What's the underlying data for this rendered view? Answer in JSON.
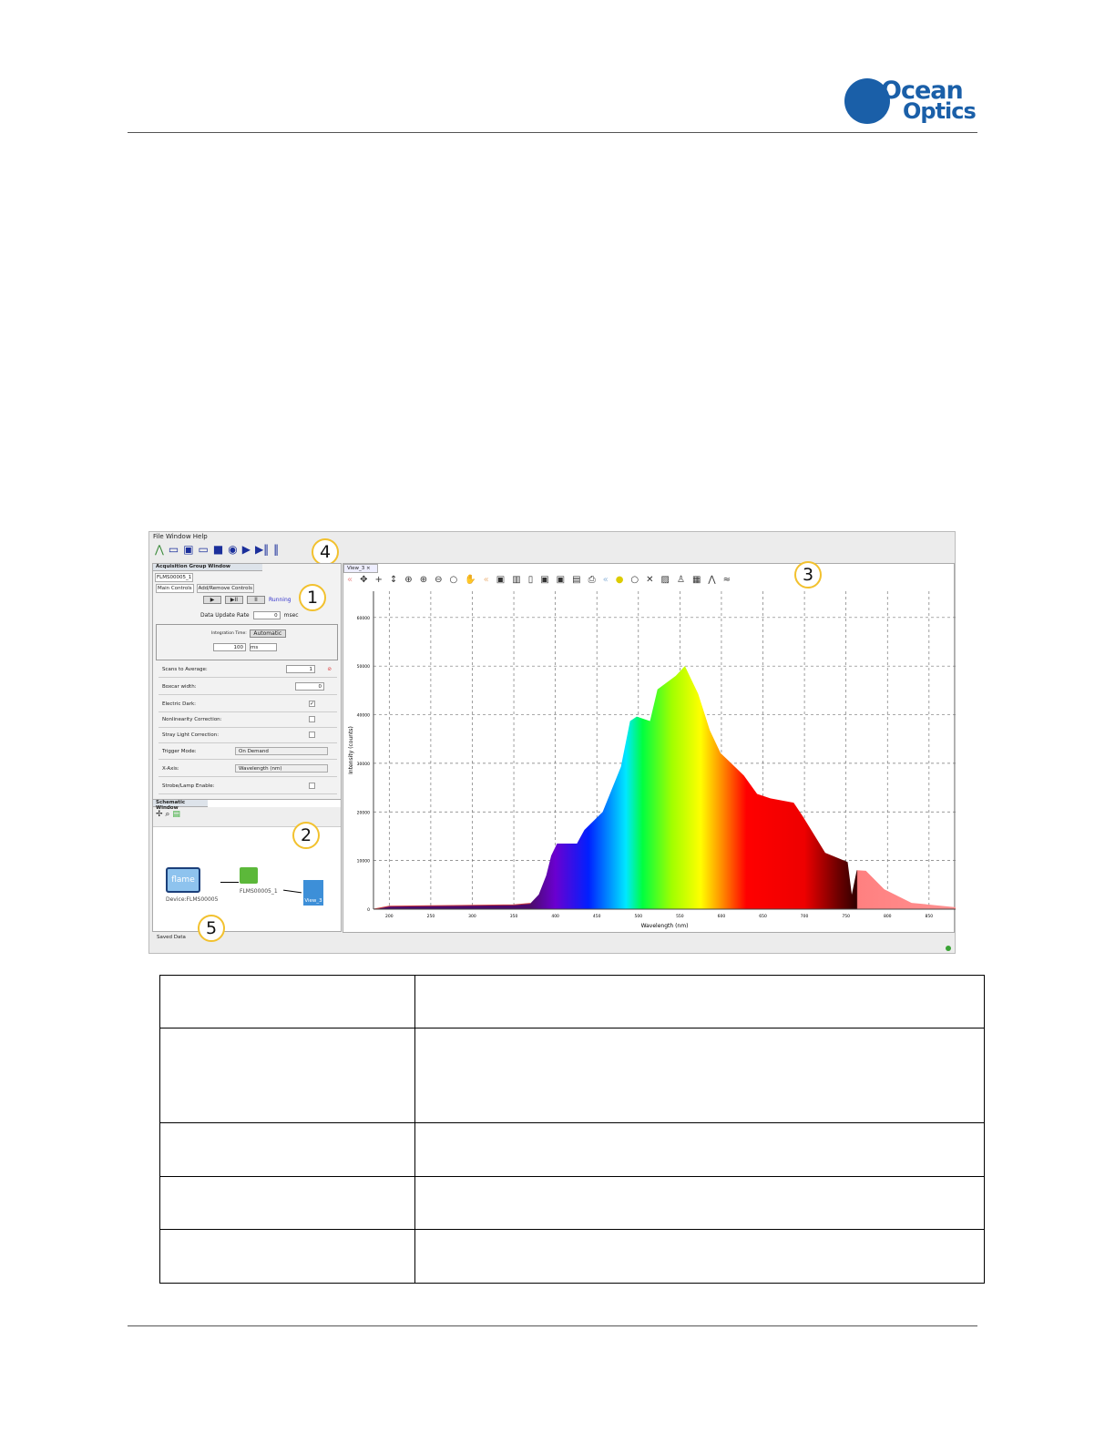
{
  "logo": {
    "text_line1": "Ocean",
    "text_line2": "Optics",
    "brand_color": "#1a5fa8"
  },
  "app": {
    "menu": "File  Window  Help",
    "callouts": [
      "1",
      "2",
      "3",
      "4",
      "5"
    ],
    "acq": {
      "title": "Acquisition Group Window",
      "device_tab": "FLMS00005_1",
      "tabs": [
        "Main Controls",
        "Add/Remove Controls"
      ],
      "play": "▶",
      "step": "▶II",
      "pause": "II",
      "status": "Running",
      "update_rate_label": "Data Update Rate",
      "update_rate": "0",
      "update_unit": "msec",
      "int_label": "Integration Time:",
      "int_auto": "Automatic",
      "int_value": "100",
      "int_unit": "ms",
      "rows": [
        {
          "label": "Scans to Average:",
          "value": "1"
        },
        {
          "label": "Boxcar width:",
          "value": "0"
        },
        {
          "label": "Electric Dark:",
          "checked": true
        },
        {
          "label": "Nonlinearity Correction:",
          "checked": false
        },
        {
          "label": "Stray Light Correction:",
          "checked": false
        },
        {
          "label": "Trigger Mode:",
          "select": "On Demand"
        },
        {
          "label": "X-Axis:",
          "select": "Wavelength (nm)"
        },
        {
          "label": "Strobe/Lamp Enable:",
          "checked": false
        }
      ]
    },
    "schematic": {
      "title": "Schematic Window",
      "device_logo": "flame",
      "device_label": "Device:FLMS00005",
      "node_label": "FLMS00005_1",
      "view_label": "View_3"
    },
    "saved_data": "Saved Data",
    "view_tab": "View_3",
    "status_color": "#3aa335"
  },
  "chart_data": {
    "type": "area",
    "xlabel": "Wavelength (nm)",
    "ylabel": "Intensity (counts)",
    "xlim": [
      181,
      882
    ],
    "ylim": [
      0,
      65400
    ],
    "xticks": [
      200,
      250,
      300,
      350,
      400,
      450,
      500,
      550,
      600,
      650,
      700,
      750,
      800,
      850
    ],
    "yticks": [
      0,
      10000,
      20000,
      30000,
      40000,
      50000,
      60000
    ],
    "grid": true,
    "x": [
      181,
      200,
      250,
      300,
      350,
      370,
      380,
      389,
      395,
      402,
      426,
      435,
      457,
      479,
      490,
      498,
      514,
      523,
      545,
      556,
      572,
      586,
      599,
      610,
      627,
      643,
      659,
      687,
      698,
      725,
      752,
      757,
      763,
      774,
      796,
      829,
      882
    ],
    "y": [
      0,
      600,
      700,
      800,
      900,
      1200,
      3000,
      6900,
      11000,
      13500,
      13500,
      16300,
      20000,
      29300,
      38700,
      39600,
      38700,
      45200,
      48000,
      50000,
      44300,
      36800,
      32100,
      30300,
      27500,
      23700,
      22800,
      21900,
      19100,
      11600,
      9700,
      3000,
      8000,
      7900,
      4100,
      1300,
      400
    ]
  },
  "table": {
    "rows": [
      [
        "",
        ""
      ],
      [
        "",
        ""
      ],
      [
        "",
        ""
      ],
      [
        "",
        ""
      ],
      [
        "",
        ""
      ]
    ]
  }
}
